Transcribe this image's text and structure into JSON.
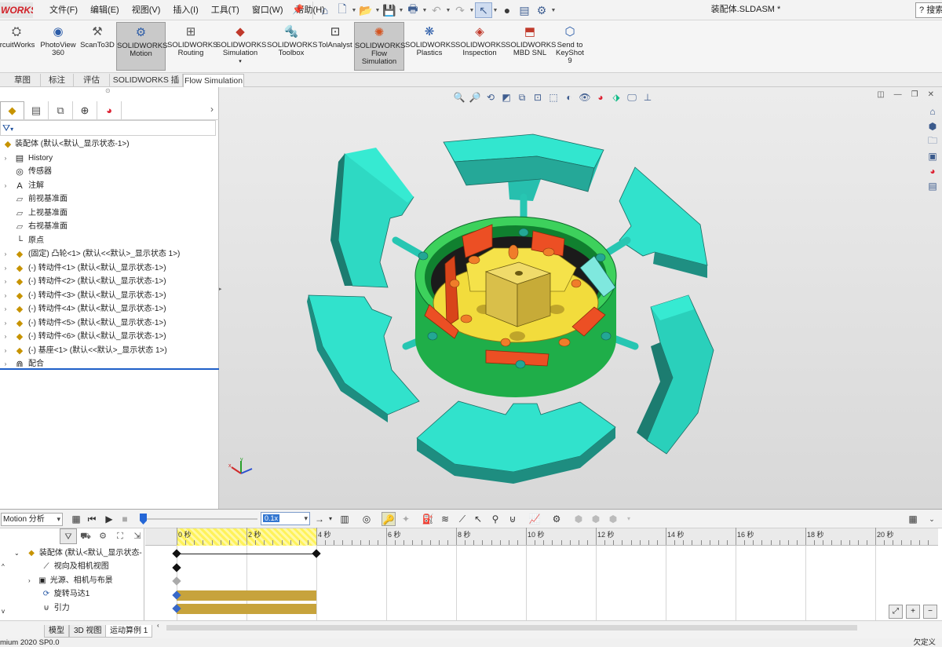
{
  "app": {
    "logo_text": "WORKS",
    "doc_title": "装配体.SLDASM *",
    "help_label": "搜索"
  },
  "menus": [
    "文件(F)",
    "编辑(E)",
    "视图(V)",
    "插入(I)",
    "工具(T)",
    "窗口(W)",
    "帮助(H)"
  ],
  "command_manager": [
    {
      "label": "ircuitWorks",
      "icon": "circuitworks-icon"
    },
    {
      "label": "PhotoView\n360",
      "icon": "photoview-icon"
    },
    {
      "label": "ScanTo3D",
      "icon": "scanto3d-icon"
    },
    {
      "label": "SOLIDWORKS\nMotion",
      "icon": "motion-icon",
      "active": true
    },
    {
      "label": "SOLIDWORKS\nRouting",
      "icon": "routing-icon"
    },
    {
      "label": "SOLIDWORKS\nSimulation",
      "icon": "simulation-icon"
    },
    {
      "label": "SOLIDWORKS\nToolbox",
      "icon": "toolbox-icon"
    },
    {
      "label": "TolAnalyst",
      "icon": "tolanalyst-icon"
    },
    {
      "label": "SOLIDWORKS\nFlow\nSimulation",
      "icon": "flow-simulation-icon",
      "active": true
    },
    {
      "label": "SOLIDWORKS\nPlastics",
      "icon": "plastics-icon"
    },
    {
      "label": "SOLIDWORKS\nInspection",
      "icon": "inspection-icon"
    },
    {
      "label": "SOLIDWORKS\nMBD SNL",
      "icon": "mbd-icon"
    },
    {
      "label": "Send to\nKeyShot\n9",
      "icon": "keyshot-icon"
    }
  ],
  "command_tabs": [
    "草图",
    "标注",
    "评估",
    "SOLIDWORKS 插件",
    "Flow Simulation"
  ],
  "selected_command_tab": "Flow Simulation",
  "feature_tree": {
    "root": "装配体 (默认<默认_显示状态-1>)",
    "items": [
      {
        "label": "History",
        "expand": true,
        "icon": "history-icon"
      },
      {
        "label": "传感器",
        "expand": false,
        "icon": "sensor-icon"
      },
      {
        "label": "注解",
        "expand": true,
        "icon": "annotation-icon"
      },
      {
        "label": "前视基准面",
        "expand": false,
        "icon": "plane-icon"
      },
      {
        "label": "上视基准面",
        "expand": false,
        "icon": "plane-icon"
      },
      {
        "label": "右视基准面",
        "expand": false,
        "icon": "plane-icon"
      },
      {
        "label": "原点",
        "expand": false,
        "icon": "origin-icon"
      },
      {
        "label": "(固定) 凸轮<1> (默认<<默认>_显示状态 1>)",
        "expand": true,
        "icon": "part-icon"
      },
      {
        "label": "(-) 转动件<1> (默认<默认_显示状态-1>)",
        "expand": true,
        "icon": "part-icon"
      },
      {
        "label": "(-) 转动件<2> (默认<默认_显示状态-1>)",
        "expand": true,
        "icon": "part-icon"
      },
      {
        "label": "(-) 转动件<3> (默认<默认_显示状态-1>)",
        "expand": true,
        "icon": "part-icon"
      },
      {
        "label": "(-) 转动件<4> (默认<默认_显示状态-1>)",
        "expand": true,
        "icon": "part-icon"
      },
      {
        "label": "(-) 转动件<5> (默认<默认_显示状态-1>)",
        "expand": true,
        "icon": "part-icon"
      },
      {
        "label": "(-) 转动件<6> (默认<默认_显示状态-1>)",
        "expand": true,
        "icon": "part-icon"
      },
      {
        "label": "(-) 基座<1> (默认<<默认>_显示状态 1>)",
        "expand": true,
        "icon": "part-icon"
      },
      {
        "label": "配合",
        "expand": true,
        "icon": "mates-icon"
      }
    ]
  },
  "motion": {
    "study_type": "Motion 分析",
    "speed": "0.1x",
    "tree": [
      "装配体 (默认<默认_显示状态-",
      "视向及相机视图",
      "光源、相机与布景",
      "旋转马达1",
      "引力"
    ],
    "ruler_labels": [
      "0 秒",
      "2 秒",
      "4 秒",
      "6 秒",
      "8 秒",
      "10 秒",
      "12 秒",
      "14 秒",
      "16 秒",
      "18 秒",
      "20 秒"
    ],
    "duration_seconds": 4,
    "bottom_tabs": [
      "模型",
      "3D 视图",
      "运动算例 1"
    ],
    "selected_tab": "运动算例 1"
  },
  "status": {
    "left": "mium 2020 SP0.0",
    "right": "欠定义"
  },
  "colors": {
    "accent": "#1e5fc8",
    "cyan_part": "#2fe0c8",
    "green_base": "#2fc15a",
    "orange_part": "#ef5a2a",
    "yellow_cam": "#f4e04a",
    "timeline_bar": "#c7a33c"
  }
}
